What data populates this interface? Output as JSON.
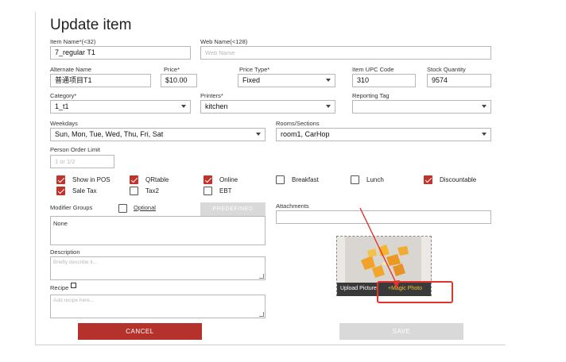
{
  "dialog": {
    "title": "Update item"
  },
  "fields": {
    "item_name": {
      "label": "Item Name*(<32)",
      "value": "7_regular T1"
    },
    "web_name": {
      "label": "Web Name(<128)",
      "placeholder": "Web Name"
    },
    "alternate_name": {
      "label": "Alternate Name",
      "value": "普通项目T1"
    },
    "price": {
      "label": "Price*",
      "value": "$10.00"
    },
    "price_type": {
      "label": "Price Type*",
      "value": "Fixed"
    },
    "upc": {
      "label": "Item UPC Code",
      "value": "310"
    },
    "stock": {
      "label": "Stock Quantity",
      "value": "9574"
    },
    "category": {
      "label": "Category*",
      "value": "1_t1"
    },
    "printers": {
      "label": "Printers*",
      "value": "kitchen"
    },
    "reporting_tag": {
      "label": "Reporting Tag",
      "value": ""
    },
    "weekdays": {
      "label": "Weekdays",
      "value": "Sun, Mon, Tue, Wed, Thu, Fri, Sat"
    },
    "rooms": {
      "label": "Rooms/Sections",
      "value": "room1, CarHop"
    },
    "person_limit": {
      "label": "Person Order Limit",
      "placeholder": "1 or 1/2"
    }
  },
  "checkboxes": [
    {
      "label": "Show in POS",
      "checked": true
    },
    {
      "label": "QRtable",
      "checked": true
    },
    {
      "label": "Online",
      "checked": true
    },
    {
      "label": "Breakfast",
      "checked": false
    },
    {
      "label": "Lunch",
      "checked": false
    },
    {
      "label": "Discountable",
      "checked": true
    },
    {
      "label": "Sale Tax",
      "checked": true
    },
    {
      "label": "Tax2",
      "checked": false
    },
    {
      "label": "EBT",
      "checked": false
    }
  ],
  "modifier": {
    "label": "Modifier Groups",
    "optional_label": "Optional",
    "predefined_label": "PREDEFINED",
    "value": "None"
  },
  "attachments": {
    "label": "Attachments"
  },
  "description": {
    "label": "Description",
    "placeholder": "Briefly describe it..."
  },
  "recipe": {
    "label": "Recipe",
    "placeholder": "Add recipe here..."
  },
  "photo": {
    "upload_label": "Upload Picture",
    "magic_label": "Magic Photo",
    "magic_prefix": "+",
    "annotation_color": "#e0342a"
  },
  "buttons": {
    "cancel": "CANCEL",
    "save": "SAVE"
  },
  "colors": {
    "accent": "#b5312b",
    "disabled": "#d9d9d9",
    "checkbox_on": "#c0342c"
  }
}
